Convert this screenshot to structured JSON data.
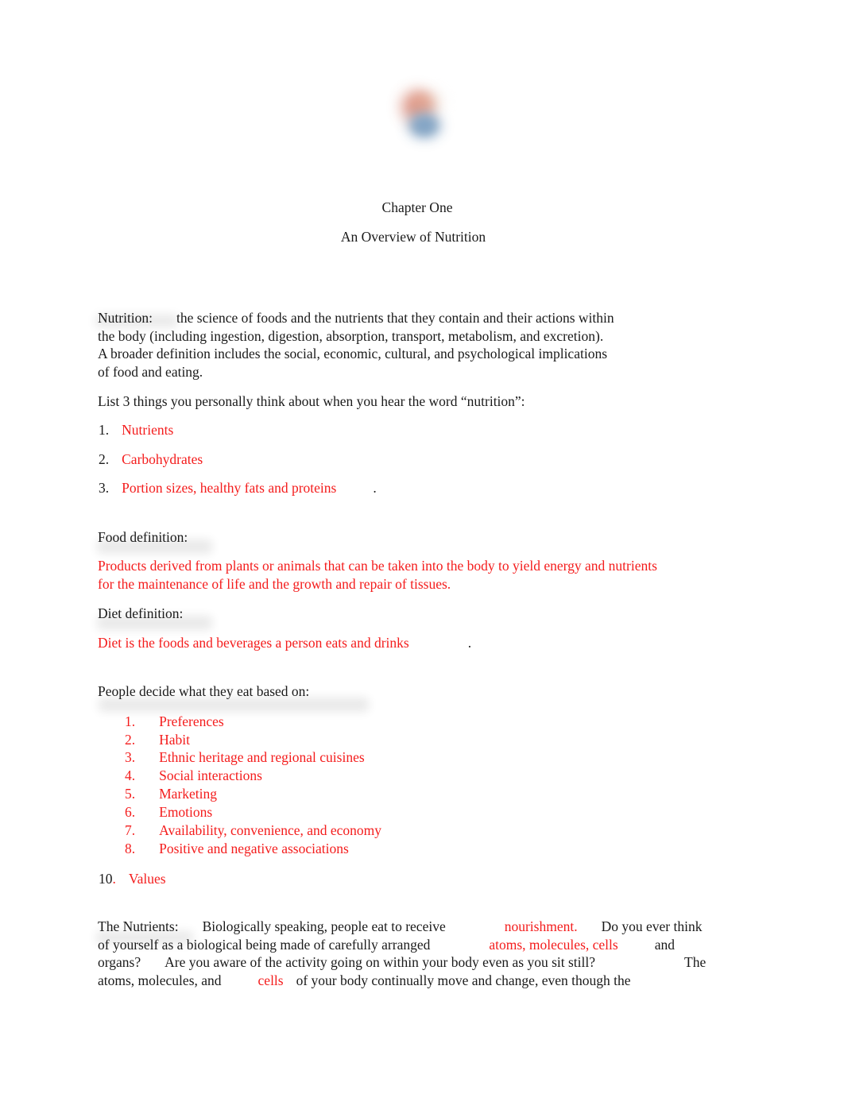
{
  "document": {
    "chapter_title": "Chapter One",
    "subtitle": "An Overview of Nutrition",
    "logo_colors": {
      "upper": "#d98b7a",
      "lower": "#8aa9c6"
    },
    "answer_color": "#f41c1c",
    "text_color": "#1a1a1a"
  },
  "nutrition_definition": {
    "label": "Nutrition:",
    "line1": "the science of foods and the nutrients that they contain and their actions within",
    "line2": "the body (including ingestion, digestion, absorption, transport, metabolism, and excretion).",
    "line3": "A broader definition includes the social, economic, cultural, and psychological implications",
    "line4": "of food and eating."
  },
  "list_prompt": {
    "text": "List 3 things you personally think about when you hear the word “nutrition”:"
  },
  "personal_list": {
    "items": [
      {
        "number": "1.",
        "answer": "Nutrients",
        "trailing": ""
      },
      {
        "number": "2.",
        "answer": "Carbohydrates",
        "trailing": ""
      },
      {
        "number": "3.",
        "answer": "Portion sizes, healthy fats and proteins",
        "trailing": "."
      }
    ]
  },
  "food_definition": {
    "label": "Food definition:",
    "answer_line1": "Products derived from plants or animals that can be taken into the body to yield energy and nutrients",
    "answer_line2": "for the maintenance of life and the growth and repair of tissues."
  },
  "diet_definition": {
    "label": "Diet definition:",
    "answer": "Diet is the foods and beverages a person eats and drinks",
    "trailing": "."
  },
  "decide_section": {
    "label": "People decide what they eat based on:",
    "items": [
      {
        "number": "1.",
        "answer": "Preferences"
      },
      {
        "number": "2.",
        "answer": "Habit"
      },
      {
        "number": "3.",
        "answer": "Ethnic heritage and regional cuisines"
      },
      {
        "number": "4.",
        "answer": "Social interactions"
      },
      {
        "number": "5.",
        "answer": "Marketing"
      },
      {
        "number": "6.",
        "answer": "Emotions"
      },
      {
        "number": "7.",
        "answer": "Availability, convenience, and economy"
      },
      {
        "number": "8.",
        "answer": "Positive and negative associations"
      }
    ],
    "extra_item": {
      "number": "10",
      "dot": ".",
      "answer": "Values"
    }
  },
  "nutrients_paragraph": {
    "label": "The Nutrients:",
    "seg1": "Biologically speaking, people eat to receive",
    "answer1": "nourishment.",
    "seg2": "Do you ever think",
    "seg3": "of yourself as a biological being made of carefully arranged",
    "answer2": "atoms, molecules, cells",
    "seg4": "and",
    "seg5": "organs?",
    "seg6": "Are you aware of the activity going on within your body even as you sit still?",
    "seg7": "The",
    "seg8": "atoms, molecules, and",
    "answer3": "cells",
    "seg9": "of your body continually move and change, even though the"
  }
}
